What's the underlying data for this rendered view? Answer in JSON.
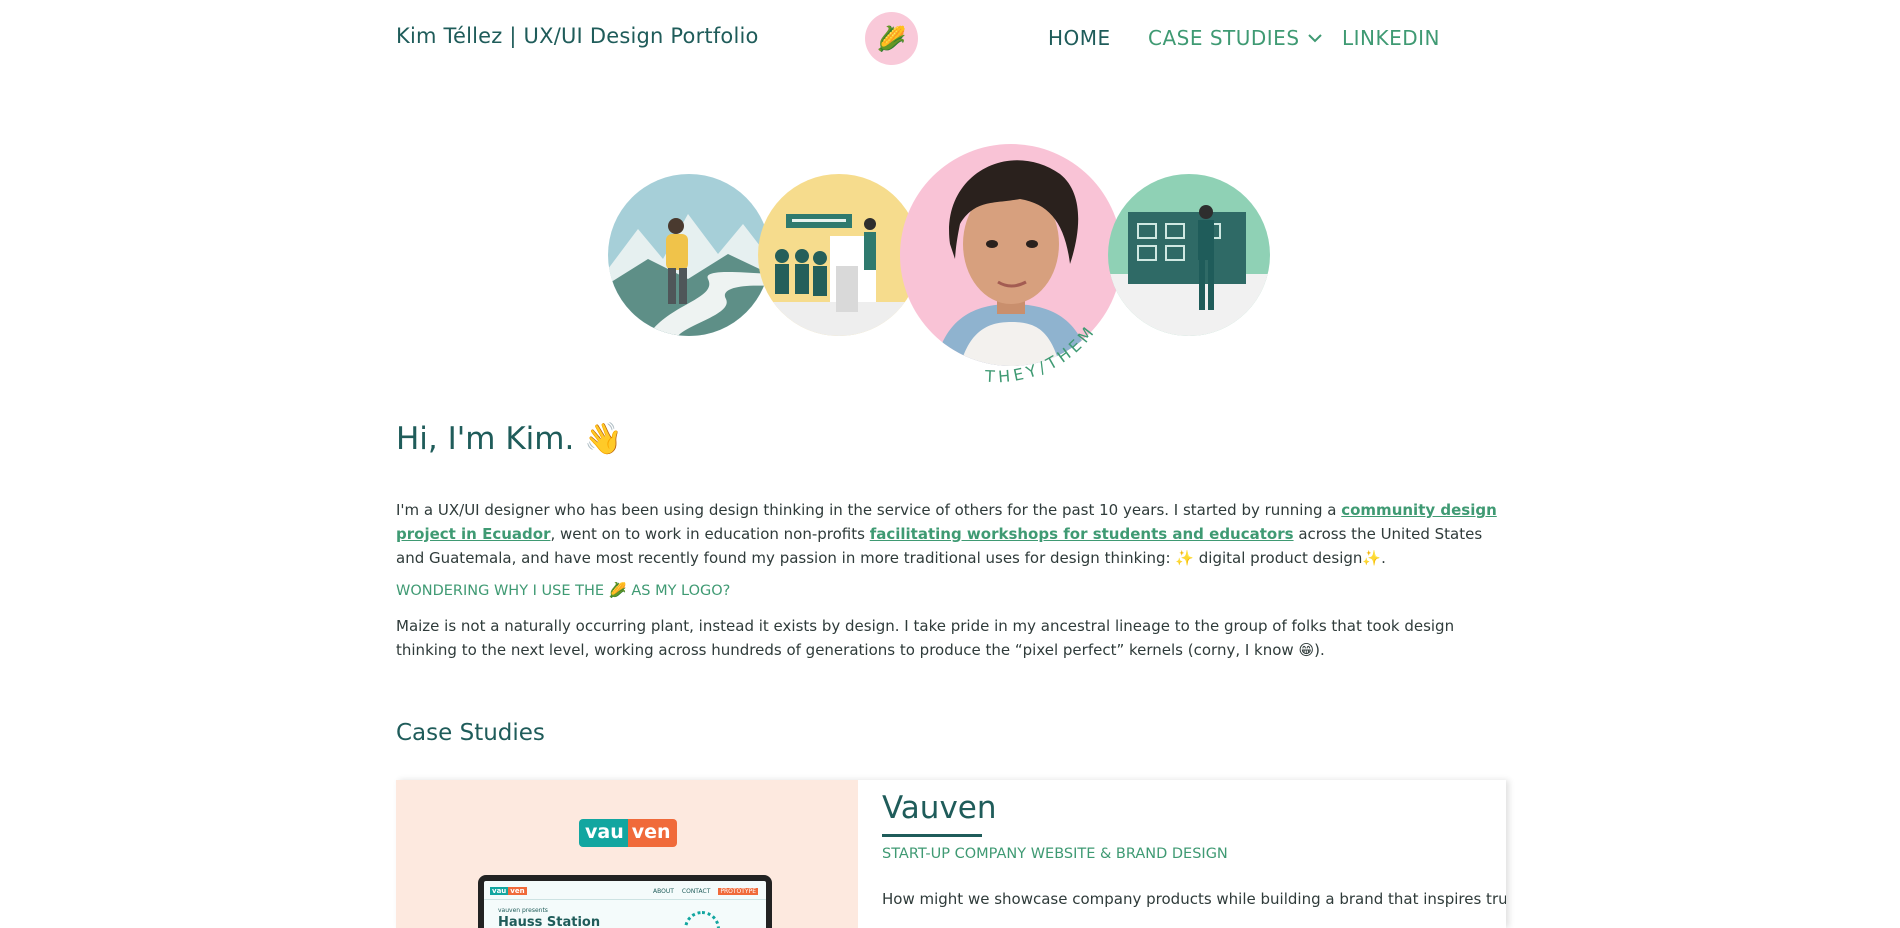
{
  "header": {
    "title": "Kim Téllez | UX/UI Design Portfolio",
    "logo_emoji": "🌽",
    "nav": {
      "home": "HOME",
      "case_studies": "CASE STUDIES",
      "linkedin": "LINKEDIN"
    }
  },
  "hero": {
    "pronouns": "THEY/THEM"
  },
  "intro": {
    "greeting": "Hi, I'm Kim. 👋",
    "p1_a": "I'm a UX/UI designer who has been using design thinking in the service of others for the past 10 years. I started by running a ",
    "link1": "community design project in Ecuador",
    "p1_b": ", went on to work in education non-profits ",
    "link2": "facilitating workshops for students and educators",
    "p1_c": " across the United States and Guatemala, and have most recently found my passion in more traditional uses for design thinking: ✨ digital product design✨.",
    "logo_question": "WONDERING WHY I USE THE 🌽 AS MY LOGO?",
    "p2": "Maize is not a naturally occurring plant, instead it exists by design. I take pride in my ancestral lineage to the group of folks that took design thinking to the next level, working across hundreds of generations to produce the “pixel perfect” kernels (corny, I know 😁)."
  },
  "case_studies": {
    "heading": "Case Studies",
    "items": [
      {
        "brand_left": "vau",
        "brand_right": "ven",
        "title": "Vauven",
        "subtitle": "START-UP COMPANY WEBSITE & BRAND DESIGN",
        "question": "How might we showcase company products while building a brand that inspires trust?",
        "screen_nav": [
          "ABOUT",
          "CONTACT",
          "PROTOTYPE"
        ],
        "screen_small": "vauven presents",
        "screen_headline": "Hauss Station"
      }
    ]
  },
  "colors": {
    "primary": "#1f5c5a",
    "accent": "#3f9a73",
    "pink": "#f9c9d9",
    "peach": "#fde9df"
  }
}
